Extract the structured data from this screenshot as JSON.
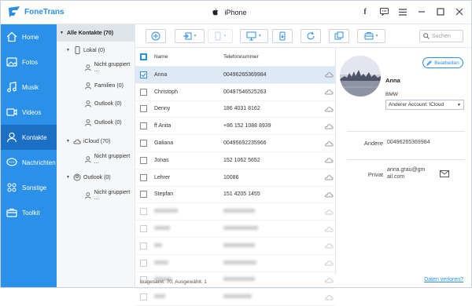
{
  "app": {
    "name": "FoneTrans",
    "device": "iPhone"
  },
  "nav": [
    {
      "label": "Home",
      "icon": "home-icon"
    },
    {
      "label": "Fotos",
      "icon": "photo-icon"
    },
    {
      "label": "Musik",
      "icon": "music-icon"
    },
    {
      "label": "Videos",
      "icon": "video-icon"
    },
    {
      "label": "Kontakte",
      "icon": "contacts-icon",
      "active": true
    },
    {
      "label": "Nachrichten",
      "icon": "messages-icon"
    },
    {
      "label": "Sonstige",
      "icon": "other-icon"
    },
    {
      "label": "Toolkit",
      "icon": "toolkit-icon"
    }
  ],
  "tree": {
    "header": "Alle Kontakte  (70)",
    "items": [
      {
        "label": "Lokal  (0)",
        "level": 1,
        "icon": "phone-icon"
      },
      {
        "label": "Nicht gruppiert ...",
        "level": 2
      },
      {
        "label": "Familien  (0)",
        "level": 2
      },
      {
        "label": "Outlook  (0)",
        "level": 2
      },
      {
        "label": "Outlook  (0)",
        "level": 2
      },
      {
        "label": "iCloud  (70)",
        "level": 1,
        "icon": "cloud-icon"
      },
      {
        "label": "Nicht gruppiert ...",
        "level": 2
      },
      {
        "label": "Outlook  (0)",
        "level": 1,
        "icon": "outlook-icon"
      },
      {
        "label": "Nicht gruppiert ...",
        "level": 2
      }
    ]
  },
  "search": {
    "placeholder": "Suchen"
  },
  "list": {
    "col_name": "Name",
    "col_tel": "Telefonnummer",
    "rows": [
      {
        "name": "Anna",
        "tel": "00496265369984"
      },
      {
        "name": "Christoph",
        "tel": "00497546525263"
      },
      {
        "name": "Denny",
        "tel": "186 4031 8162"
      },
      {
        "name": "ff Anita",
        "tel": "+86 152 1088 8939"
      },
      {
        "name": "Galiana",
        "tel": "00495692235966"
      },
      {
        "name": "Jonas",
        "tel": "152 1062 5652"
      },
      {
        "name": "Lehrer",
        "tel": "10086"
      },
      {
        "name": "Stepfan",
        "tel": "151 4205 1455"
      },
      {
        "name": "",
        "tel": ""
      },
      {
        "name": "",
        "tel": ""
      },
      {
        "name": "",
        "tel": ""
      },
      {
        "name": "",
        "tel": ""
      },
      {
        "name": "",
        "tel": ""
      },
      {
        "name": "",
        "tel": ""
      }
    ],
    "footer": "Insgesamt: 70; Ausgewählt: 1",
    "lost_link": "Daten verloren?"
  },
  "detail": {
    "edit_label": "Bearbeiten",
    "name": "Anna",
    "company": "BMW",
    "account": "Anderer Account: iCloud",
    "other_label": "Andere",
    "other_value": "00496265369984",
    "private_label": "Privat",
    "private_value_1": "anna.grau@gm",
    "private_value_2": "ail.com"
  },
  "colors": {
    "accent": "#2b90e8",
    "nav_active": "#1b6fc4",
    "selection": "#dde9f5"
  }
}
